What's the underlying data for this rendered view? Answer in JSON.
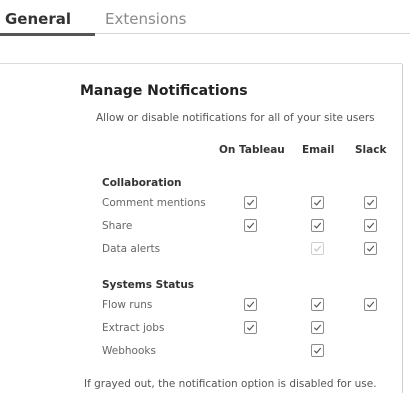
{
  "tabs": {
    "general": "General",
    "extensions": "Extensions"
  },
  "section": {
    "title": "Manage Notifications",
    "description": "Allow or disable notifications for all of your site users"
  },
  "columns": [
    "On Tableau",
    "Email",
    "Slack"
  ],
  "groups": [
    {
      "title": "Collaboration",
      "rows": [
        {
          "label": "Comment mentions",
          "tableau": "checked",
          "email": "checked",
          "slack": "checked"
        },
        {
          "label": "Share",
          "tableau": "checked",
          "email": "checked",
          "slack": "checked"
        },
        {
          "label": "Data alerts",
          "tableau": "none",
          "email": "disabled-checked",
          "slack": "checked"
        }
      ]
    },
    {
      "title": "Systems Status",
      "rows": [
        {
          "label": "Flow runs",
          "tableau": "checked",
          "email": "checked",
          "slack": "checked"
        },
        {
          "label": "Extract jobs",
          "tableau": "checked",
          "email": "checked",
          "slack": "none"
        },
        {
          "label": "Webhooks",
          "tableau": "none",
          "email": "checked",
          "slack": "none"
        }
      ]
    }
  ],
  "footnote": "If grayed out, the notification option is disabled for use.",
  "colors": {
    "check": "#555555",
    "check_disabled": "#c4c4c4",
    "tab_underline": "#555555"
  }
}
